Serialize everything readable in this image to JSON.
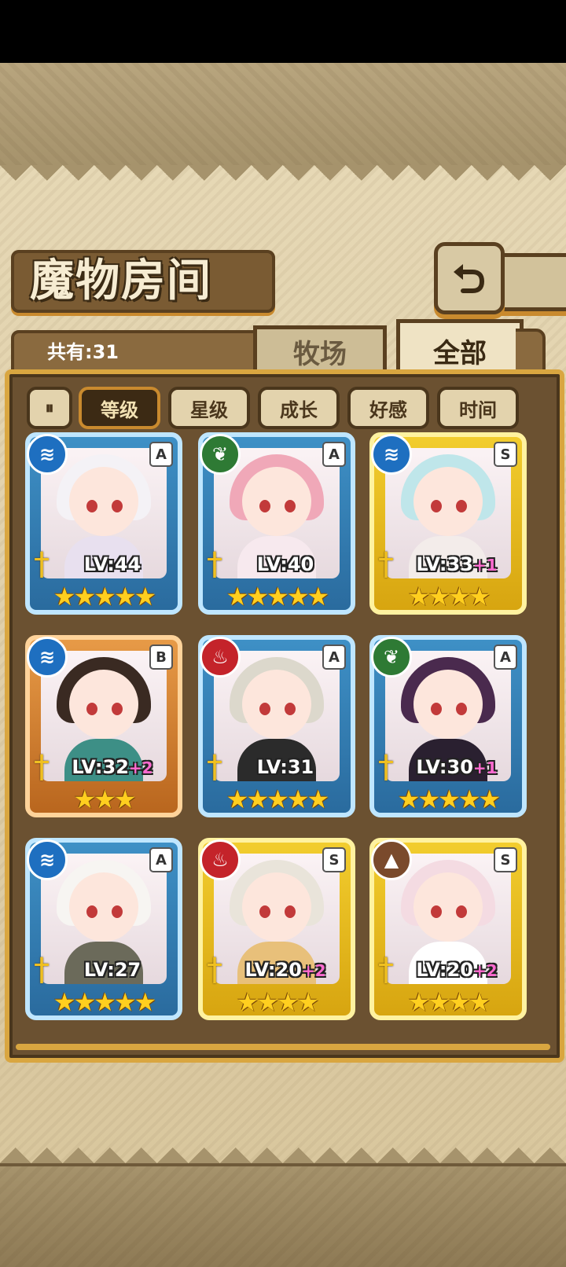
{
  "title": "魔物房间",
  "count_label": "共有:31",
  "tabs": {
    "inactive": "牧场",
    "active": "全部"
  },
  "sort_toggle": "⏸",
  "sort_options": [
    "等级",
    "星级",
    "成长",
    "好感",
    "时间"
  ],
  "selected_sort": "等级",
  "cards": [
    {
      "element": "water",
      "rank": "A",
      "level": "LV:44",
      "bonus": "",
      "stars": 5,
      "frame": "A",
      "hair": "#f4f2f6",
      "outfit": "#e8e0ef"
    },
    {
      "element": "leaf",
      "rank": "A",
      "level": "LV:40",
      "bonus": "",
      "stars": 5,
      "frame": "A",
      "hair": "#f0a8b8",
      "outfit": "#f7e9ee"
    },
    {
      "element": "water",
      "rank": "S",
      "level": "LV:33",
      "bonus": "+1",
      "stars": 4,
      "frame": "S",
      "hair": "#bfe6ea",
      "outfit": "#f3ecea"
    },
    {
      "element": "water",
      "rank": "B",
      "level": "LV:32",
      "bonus": "+2",
      "stars": 3,
      "frame": "B",
      "hair": "#3a2a22",
      "outfit": "#3d8f86"
    },
    {
      "element": "fire",
      "rank": "A",
      "level": "LV:31",
      "bonus": "",
      "stars": 5,
      "frame": "A",
      "hair": "#dcd8cc",
      "outfit": "#2b2b2b"
    },
    {
      "element": "leaf",
      "rank": "A",
      "level": "LV:30",
      "bonus": "+1",
      "stars": 5,
      "frame": "A",
      "hair": "#4a2a4e",
      "outfit": "#2a2030"
    },
    {
      "element": "water",
      "rank": "A",
      "level": "LV:27",
      "bonus": "",
      "stars": 5,
      "frame": "A",
      "hair": "#f7f5f2",
      "outfit": "#6b6a5a"
    },
    {
      "element": "fire",
      "rank": "S",
      "level": "LV:20",
      "bonus": "+2",
      "stars": 4,
      "frame": "S",
      "hair": "#e9e4da",
      "outfit": "#e8c07a"
    },
    {
      "element": "earth",
      "rank": "S",
      "level": "LV:20",
      "bonus": "+2",
      "stars": 4,
      "frame": "S",
      "hair": "#f4dbe2",
      "outfit": "#ffffff"
    }
  ],
  "element_icons": {
    "water": "≋",
    "leaf": "❦",
    "fire": "♨",
    "earth": "▲"
  },
  "colors": {
    "frame_gold": "#d9a640",
    "panel": "#6b5131",
    "selected_sort_bg": "#3c2a14"
  }
}
